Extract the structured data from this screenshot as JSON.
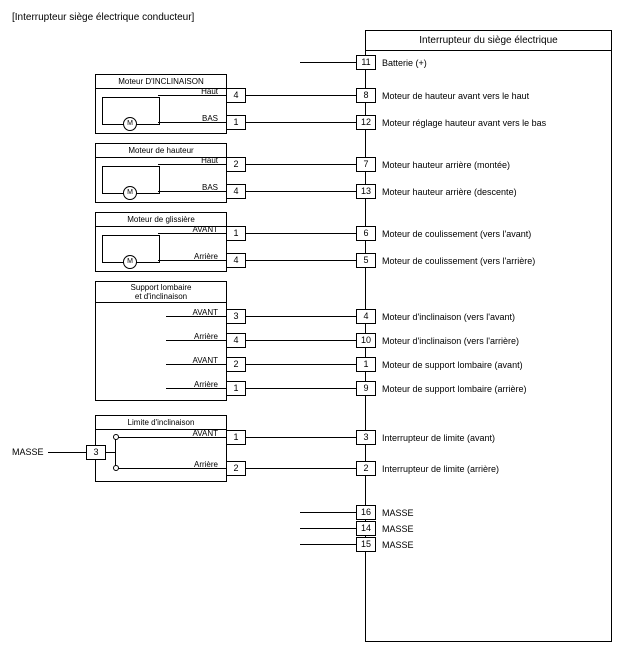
{
  "title": "[Interrupteur siège électrique conducteur]",
  "main_box": {
    "header": "Interrupteur du siège électrique"
  },
  "left_externals": {
    "masse_label": "MASSE",
    "masse_pin": "3"
  },
  "rows": {
    "battery": {
      "right_pin": "11",
      "desc": "Batterie (+)"
    },
    "tilt_hi": {
      "motor_title": "Moteur D'INCLINAISON",
      "sig": "Haut",
      "left_pin": "4",
      "right_pin": "8",
      "desc": "Moteur de hauteur avant vers le haut"
    },
    "tilt_lo": {
      "sig": "BAS",
      "left_pin": "1",
      "right_pin": "12",
      "desc": "Moteur réglage hauteur avant vers le bas"
    },
    "hgt_hi": {
      "motor_title": "Moteur de hauteur",
      "sig": "Haut",
      "left_pin": "2",
      "right_pin": "7",
      "desc": "Moteur hauteur arrière (montée)"
    },
    "hgt_lo": {
      "sig": "BAS",
      "left_pin": "4",
      "right_pin": "13",
      "desc": "Moteur hauteur arrière (descente)"
    },
    "sld_f": {
      "motor_title": "Moteur de glissière",
      "sig": "AVANT",
      "left_pin": "1",
      "right_pin": "6",
      "desc": "Moteur de coulissement (vers l'avant)"
    },
    "sld_r": {
      "sig": "Arrière",
      "left_pin": "4",
      "right_pin": "5",
      "desc": "Moteur de coulissement (vers l'arrière)"
    },
    "sup_title": {
      "motor_title_l1": "Support lombaire",
      "motor_title_l2": "et d'inclinaison"
    },
    "sup_f1": {
      "sig": "AVANT",
      "left_pin": "3",
      "right_pin": "4",
      "desc": "Moteur d'inclinaison (vers l'avant)"
    },
    "sup_r1": {
      "sig": "Arrière",
      "left_pin": "4",
      "right_pin": "10",
      "desc": "Moteur d'inclinaison (vers l'arrière)"
    },
    "sup_f2": {
      "sig": "AVANT",
      "left_pin": "2",
      "right_pin": "1",
      "desc": "Moteur de support lombaire (avant)"
    },
    "sup_r2": {
      "sig": "Arrière",
      "left_pin": "1",
      "right_pin": "9",
      "desc": "Moteur de support lombaire (arrière)"
    },
    "lim_title": {
      "motor_title": "Limite d'inclinaison"
    },
    "lim_f": {
      "sig": "AVANT",
      "left_pin": "1",
      "right_pin": "3",
      "desc": "Interrupteur de limite (avant)"
    },
    "lim_r": {
      "sig": "Arrière",
      "left_pin": "2",
      "right_pin": "2",
      "desc": "Interrupteur de limite (arrière)"
    },
    "gnd1": {
      "right_pin": "16",
      "desc": "MASSE"
    },
    "gnd2": {
      "right_pin": "14",
      "desc": "MASSE"
    },
    "gnd3": {
      "right_pin": "15",
      "desc": "MASSE"
    }
  },
  "motor_symbol": "M"
}
